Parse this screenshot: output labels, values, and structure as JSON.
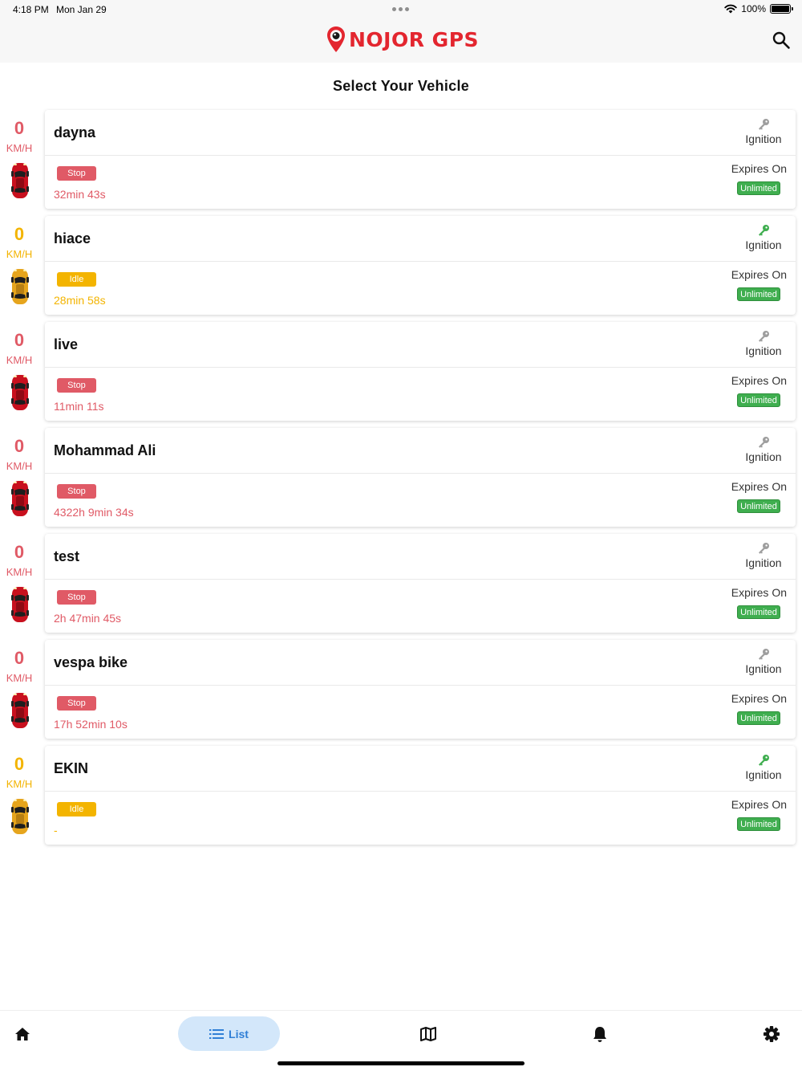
{
  "status_bar": {
    "time": "4:18 PM",
    "date": "Mon Jan 29",
    "battery": "100%"
  },
  "header": {
    "brand": "NOJOR GPS",
    "search_icon": "search-icon"
  },
  "page": {
    "title": "Select Your Vehicle"
  },
  "colors": {
    "stop": "#e05a66",
    "idle": "#f3b400",
    "active_key": "#3fae4f",
    "inactive_key": "#9e9e9e",
    "unlimited": "#3fae4f",
    "brand": "#e3262f"
  },
  "labels": {
    "speed_unit": "KM/H",
    "ignition": "Ignition",
    "expires_on": "Expires On",
    "unlimited": "Unlimited"
  },
  "vehicles": [
    {
      "speed": "0",
      "name": "dayna",
      "status": "Stop",
      "duration": "32min 43s",
      "ignition_on": false
    },
    {
      "speed": "0",
      "name": "hiace",
      "status": "Idle",
      "duration": "28min 58s",
      "ignition_on": true
    },
    {
      "speed": "0",
      "name": "live",
      "status": "Stop",
      "duration": "11min 11s",
      "ignition_on": false
    },
    {
      "speed": "0",
      "name": "Mohammad Ali",
      "status": "Stop",
      "duration": "4322h 9min 34s",
      "ignition_on": false
    },
    {
      "speed": "0",
      "name": "test",
      "status": "Stop",
      "duration": "2h 47min 45s",
      "ignition_on": false
    },
    {
      "speed": "0",
      "name": "vespa bike",
      "status": "Stop",
      "duration": "17h 52min 10s",
      "ignition_on": false
    },
    {
      "speed": "0",
      "name": "EKIN",
      "status": "Idle",
      "duration": "-",
      "ignition_on": true
    }
  ],
  "bottom_nav": {
    "list_label": "List",
    "items": [
      "home-icon",
      "list-icon",
      "map-icon",
      "bell-icon",
      "gear-icon"
    ]
  }
}
